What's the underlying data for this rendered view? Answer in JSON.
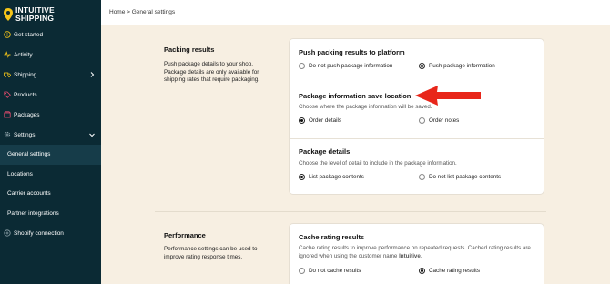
{
  "brand": {
    "name_line1": "INTUITIVE",
    "name_line2": "SHIPPING"
  },
  "sidebar": {
    "items": [
      {
        "label": "Get started",
        "icon": "info-icon"
      },
      {
        "label": "Activity",
        "icon": "activity-icon"
      },
      {
        "label": "Shipping",
        "icon": "truck-icon"
      },
      {
        "label": "Products",
        "icon": "tag-icon"
      },
      {
        "label": "Packages",
        "icon": "package-icon"
      },
      {
        "label": "Settings",
        "icon": "gear-icon"
      }
    ],
    "sub_items": [
      {
        "label": "General settings"
      },
      {
        "label": "Locations"
      },
      {
        "label": "Carrier accounts"
      },
      {
        "label": "Partner integrations"
      }
    ],
    "shopify": {
      "label": "Shopify connection",
      "icon": "link-icon"
    }
  },
  "breadcrumb": {
    "text": "Home > General settings"
  },
  "packing": {
    "title": "Packing results",
    "desc1": "Push package details to your shop.",
    "desc2": "Package details are only available for",
    "desc3": "shipping rates that require packaging.",
    "push": {
      "heading": "Push packing results to platform",
      "opt1": "Do not push package information",
      "opt2": "Push package information"
    },
    "save": {
      "heading": "Package information save location",
      "desc": "Choose where the package information will be saved.",
      "opt1": "Order details",
      "opt2": "Order notes"
    },
    "details": {
      "heading": "Package details",
      "desc": "Choose the level of detail to include in the package information.",
      "opt1": "List package contents",
      "opt2": "Do not list package contents"
    }
  },
  "performance": {
    "title": "Performance",
    "desc1": "Performance settings can be used to",
    "desc2": "improve rating response times.",
    "cache": {
      "heading": "Cache rating results",
      "desc1": "Cache rating results to improve performance on repeated requests. Cached rating results are",
      "desc2_a": "ignored when using the customer name ",
      "desc2_b": "Intuitive",
      "desc2_c": ".",
      "opt1": "Do not cache results",
      "opt2": "Cache rating results"
    }
  },
  "colors": {
    "sidebar": "#0b2a34",
    "accent_arrow": "#e8261a",
    "logo_yellow": "#f5c518"
  }
}
